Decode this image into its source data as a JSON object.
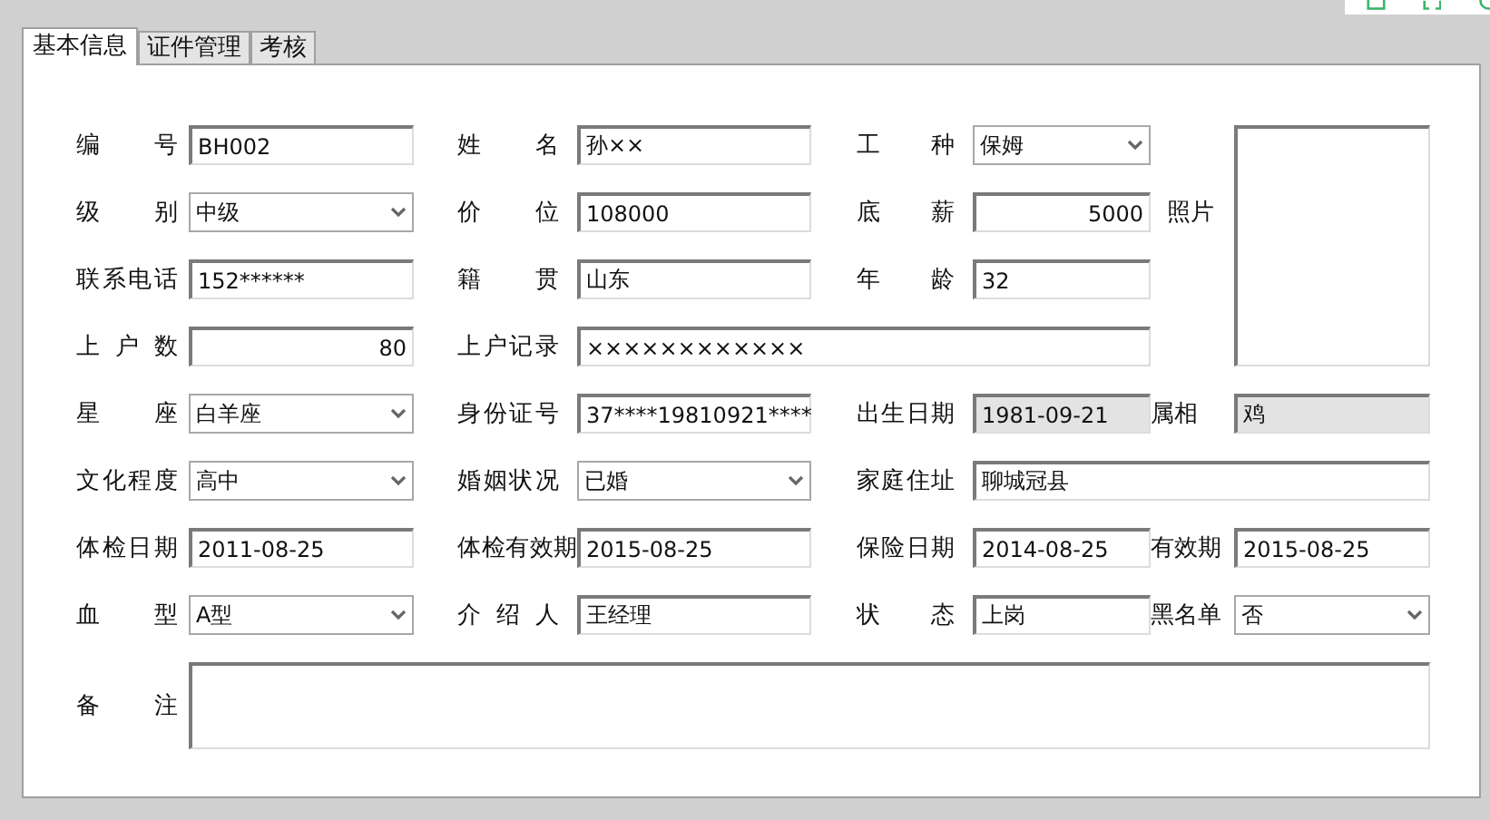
{
  "tabs": [
    {
      "label": "基本信息",
      "selected": true
    },
    {
      "label": "证件管理",
      "selected": false
    },
    {
      "label": "考核",
      "selected": false
    }
  ],
  "fields": [
    {
      "label": "编号",
      "value": "BH002",
      "kind": "text"
    },
    {
      "label": "姓名",
      "value": "孙××",
      "kind": "text"
    },
    {
      "label": "工种",
      "value": "保姆",
      "kind": "select"
    },
    {
      "label": "级别",
      "value": "中级",
      "kind": "select"
    },
    {
      "label": "价位",
      "value": "108000",
      "kind": "text"
    },
    {
      "label": "底薪",
      "value": "5000",
      "kind": "number"
    },
    {
      "label": "联系电话",
      "value": "152******",
      "kind": "text"
    },
    {
      "label": "籍贯",
      "value": "山东",
      "kind": "text"
    },
    {
      "label": "年龄",
      "value": "32",
      "kind": "text"
    },
    {
      "label": "上户数",
      "value": "80",
      "kind": "number"
    },
    {
      "label": "上户记录",
      "value": "××××××××××××",
      "kind": "text"
    },
    {
      "label": "星座",
      "value": "白羊座",
      "kind": "select"
    },
    {
      "label": "身份证号",
      "value": "37****19810921****",
      "kind": "text"
    },
    {
      "label": "出生日期",
      "value": "1981-09-21",
      "kind": "readonly"
    },
    {
      "label": "属相",
      "value": "鸡",
      "kind": "readonly"
    },
    {
      "label": "文化程度",
      "value": "高中",
      "kind": "select"
    },
    {
      "label": "婚姻状况",
      "value": "已婚",
      "kind": "select"
    },
    {
      "label": "家庭住址",
      "value": "聊城冠县",
      "kind": "text"
    },
    {
      "label": "体检日期",
      "value": "2011-08-25",
      "kind": "text"
    },
    {
      "label": "体检有效期",
      "value": "2015-08-25",
      "kind": "text"
    },
    {
      "label": "保险日期",
      "value": "2014-08-25",
      "kind": "text"
    },
    {
      "label": "有效期",
      "value": "2015-08-25",
      "kind": "text"
    },
    {
      "label": "血型",
      "value": "A型",
      "kind": "select"
    },
    {
      "label": "介绍人",
      "value": "王经理",
      "kind": "text"
    },
    {
      "label": "状态",
      "value": "上岗",
      "kind": "text"
    },
    {
      "label": "黑名单",
      "value": "否",
      "kind": "select"
    },
    {
      "label": "备注",
      "kind": "textarea"
    }
  ],
  "photo": {
    "label": "照片"
  }
}
